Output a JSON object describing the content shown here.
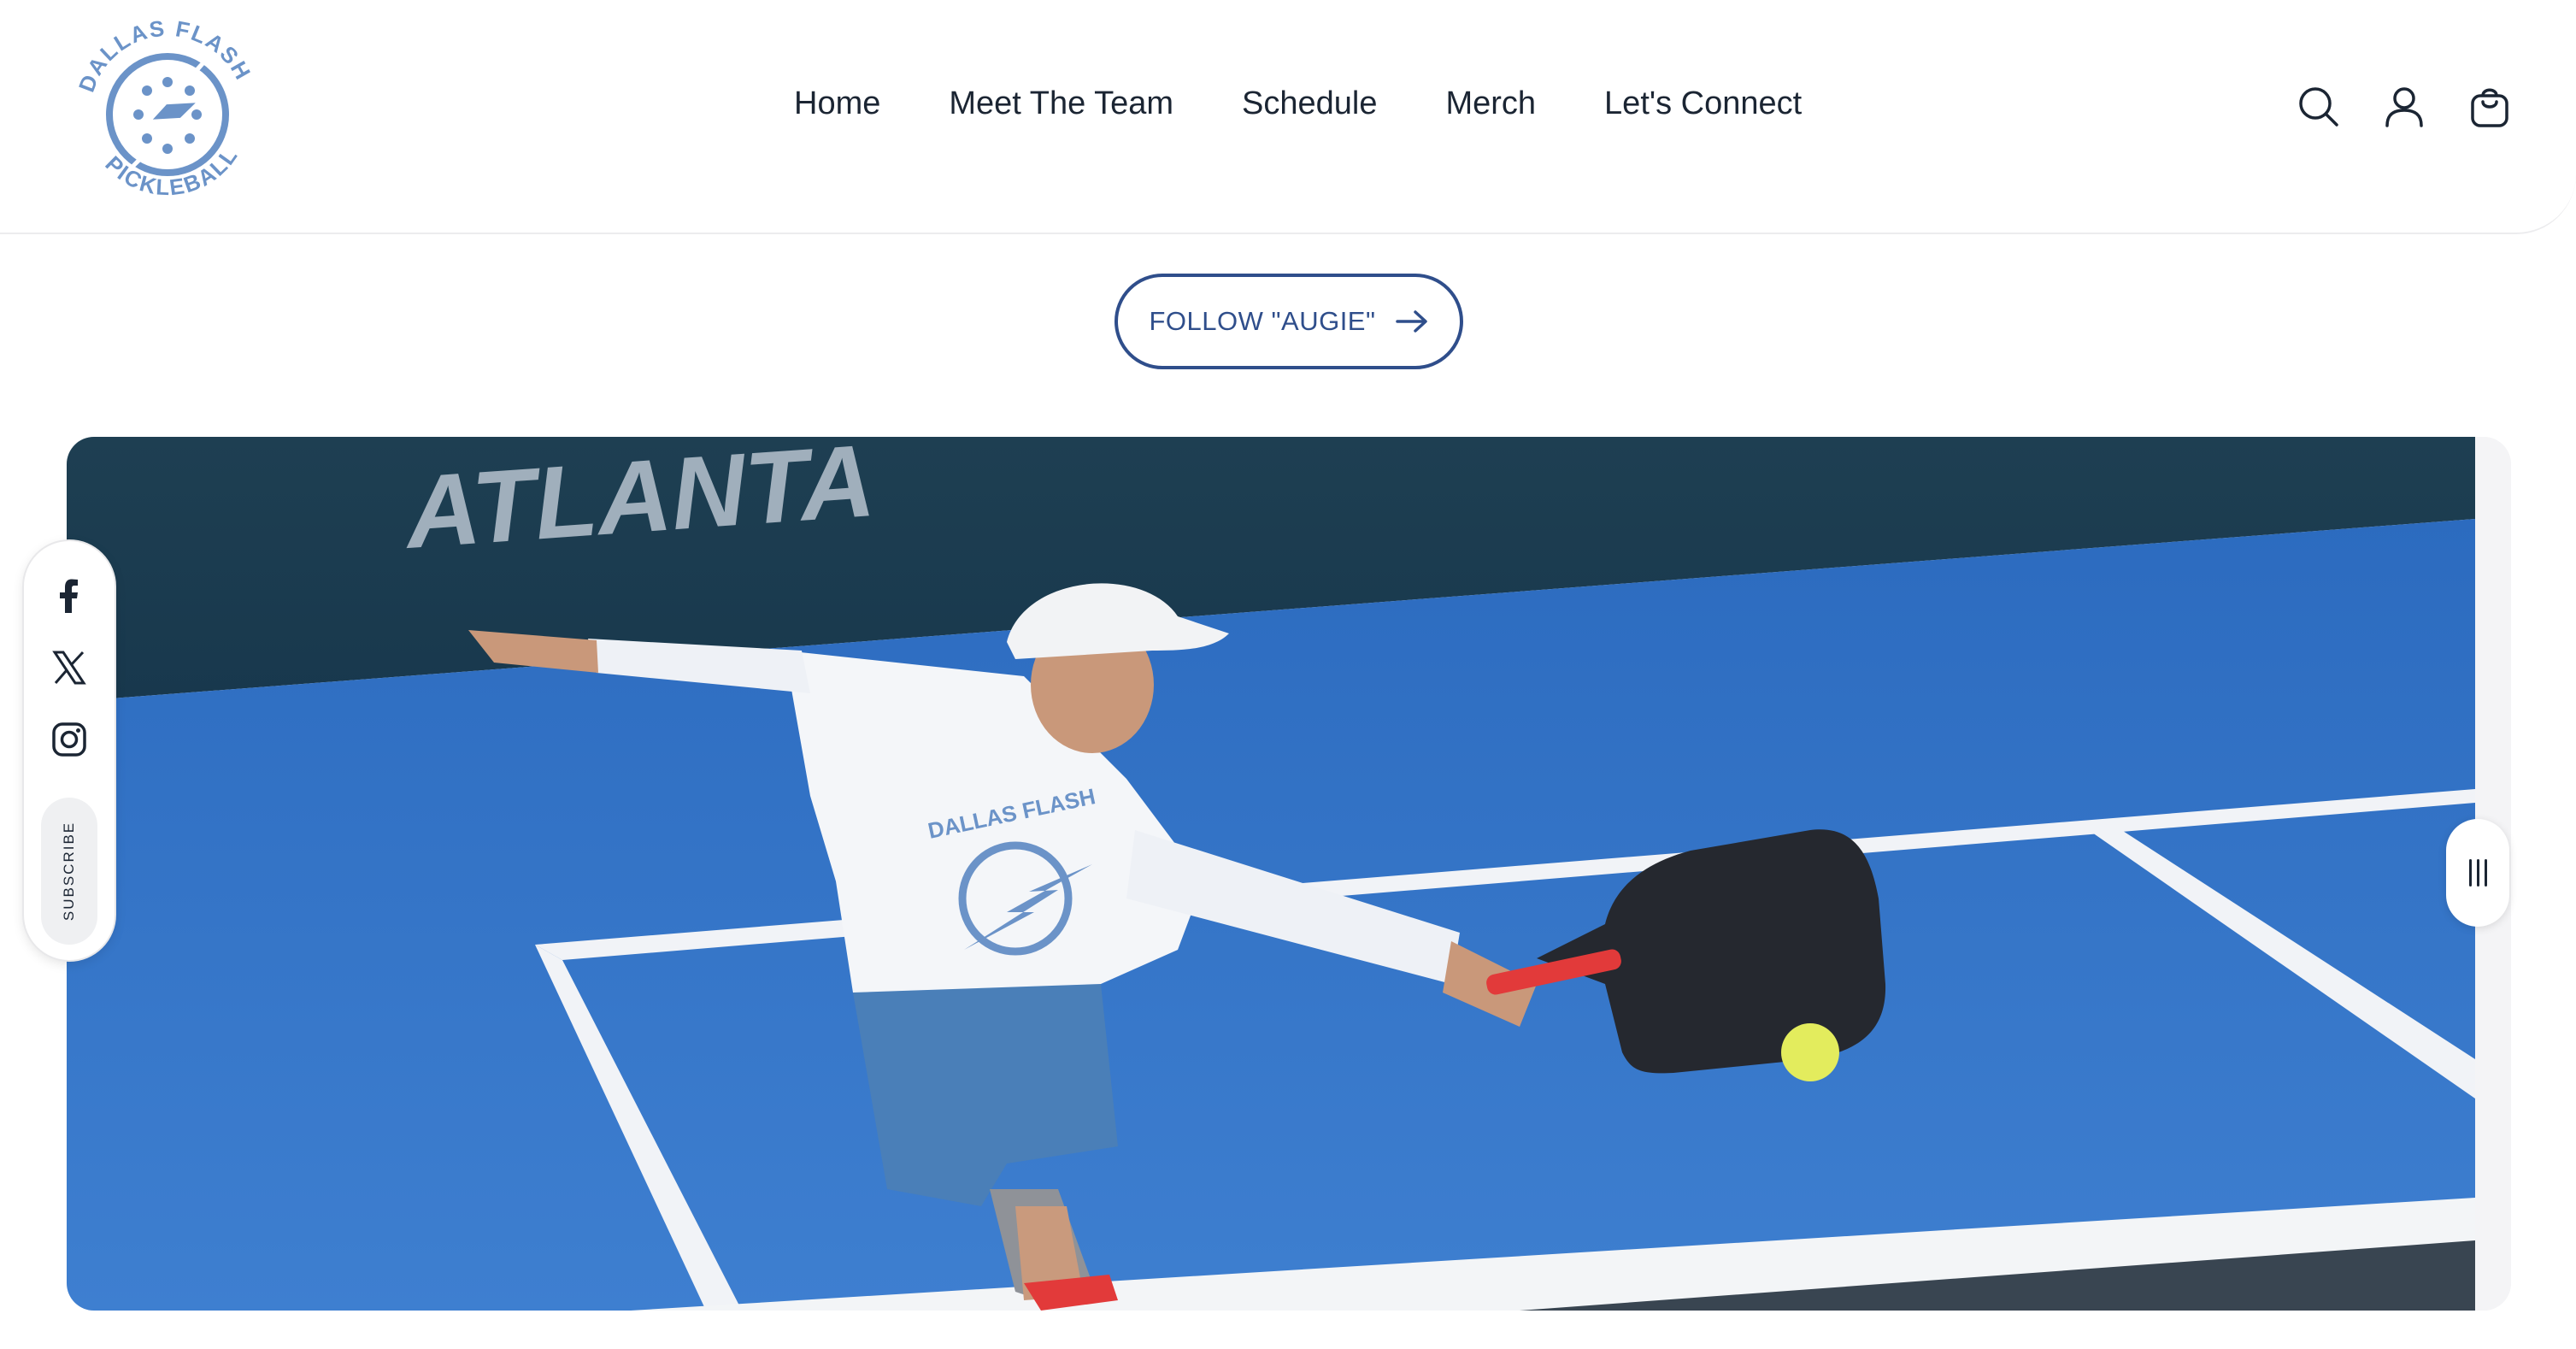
{
  "brand": {
    "logo_ring_text_top": "DALLAS FLASH",
    "logo_ring_text_bottom": "PICKLEBALL",
    "color_primary": "#6b93c8",
    "color_navy": "#2f4e8b"
  },
  "nav": {
    "items": [
      {
        "label": "Home"
      },
      {
        "label": "Meet The Team"
      },
      {
        "label": "Schedule"
      },
      {
        "label": "Merch"
      },
      {
        "label": "Let's Connect"
      }
    ]
  },
  "header_icons": [
    "search-icon",
    "account-icon",
    "cart-icon"
  ],
  "cta": {
    "label": "FOLLOW \"AUGIE\"",
    "icon": "arrow-right-icon"
  },
  "hero": {
    "banner_text": "ATLANTA",
    "shirt_text": "DALLAS FLASH",
    "court_color": "#2f6fc4"
  },
  "social": {
    "icons": [
      "facebook-icon",
      "x-icon",
      "instagram-icon"
    ],
    "subscribe_label": "SUBSCRIBE"
  }
}
